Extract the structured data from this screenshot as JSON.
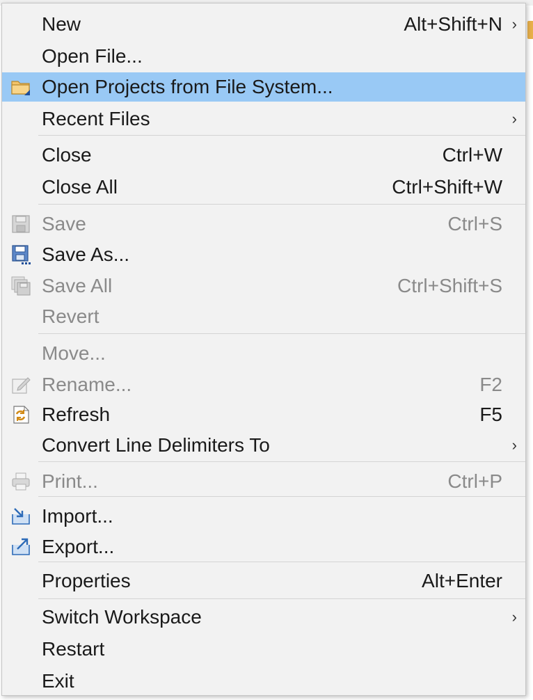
{
  "menu": {
    "new": {
      "label": "New",
      "shortcut": "Alt+Shift+N"
    },
    "open_file": {
      "label": "Open File..."
    },
    "open_projects": {
      "label": "Open Projects from File System..."
    },
    "recent_files": {
      "label": "Recent Files"
    },
    "close": {
      "label": "Close",
      "shortcut": "Ctrl+W"
    },
    "close_all": {
      "label": "Close All",
      "shortcut": "Ctrl+Shift+W"
    },
    "save": {
      "label": "Save",
      "shortcut": "Ctrl+S"
    },
    "save_as": {
      "label": "Save As..."
    },
    "save_all": {
      "label": "Save All",
      "shortcut": "Ctrl+Shift+S"
    },
    "revert": {
      "label": "Revert"
    },
    "move": {
      "label": "Move..."
    },
    "rename": {
      "label": "Rename...",
      "shortcut": "F2"
    },
    "refresh": {
      "label": "Refresh",
      "shortcut": "F5"
    },
    "convert": {
      "label": "Convert Line Delimiters To"
    },
    "print": {
      "label": "Print...",
      "shortcut": "Ctrl+P"
    },
    "import": {
      "label": "Import..."
    },
    "export": {
      "label": "Export..."
    },
    "properties": {
      "label": "Properties",
      "shortcut": "Alt+Enter"
    },
    "switch_workspace": {
      "label": "Switch Workspace"
    },
    "restart": {
      "label": "Restart"
    },
    "exit": {
      "label": "Exit"
    }
  },
  "arrow_glyph": "›",
  "colors": {
    "menu_bg": "#f2f2f2",
    "selected_bg": "#99c9f5",
    "disabled_text": "#8a8a8a",
    "separator": "#d4d4d4"
  },
  "icons": {
    "open_projects": "folder-icon",
    "save": "save-icon",
    "save_as": "save-as-icon",
    "save_all": "save-all-icon",
    "rename": "rename-icon",
    "refresh": "refresh-icon",
    "print": "print-icon",
    "import": "import-icon",
    "export": "export-icon"
  }
}
